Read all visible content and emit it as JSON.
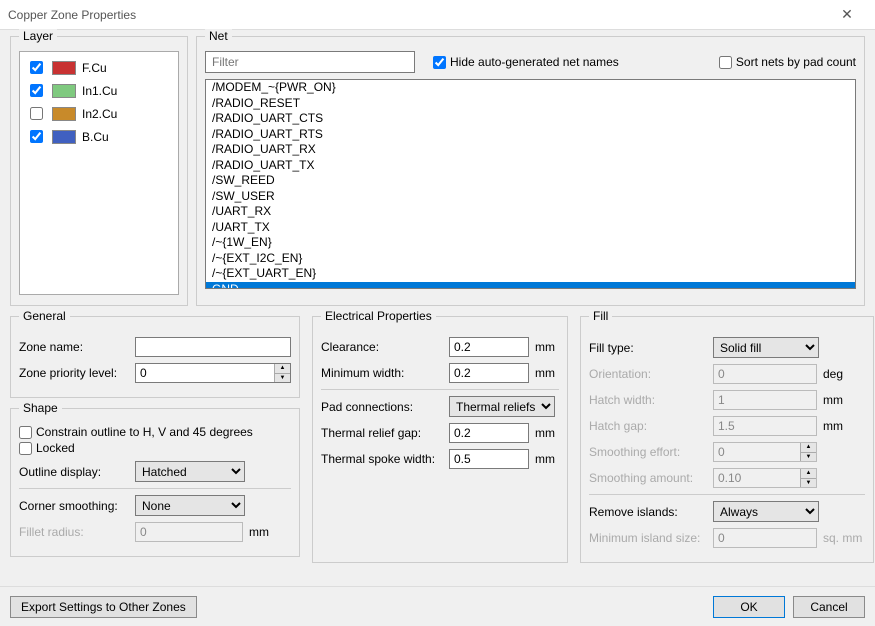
{
  "window": {
    "title": "Copper Zone Properties"
  },
  "layer": {
    "group_title": "Layer",
    "items": [
      {
        "name": "F.Cu",
        "color": "#c83232",
        "checked": true
      },
      {
        "name": "In1.Cu",
        "color": "#7fc97f",
        "checked": true
      },
      {
        "name": "In2.Cu",
        "color": "#c88a2a",
        "checked": false
      },
      {
        "name": "B.Cu",
        "color": "#4060c0",
        "checked": true
      }
    ]
  },
  "net": {
    "group_title": "Net",
    "filter_placeholder": "Filter",
    "hide_auto": {
      "label": "Hide auto-generated net names",
      "checked": true
    },
    "sort_by_pad": {
      "label": "Sort nets by pad count",
      "checked": false
    },
    "items": [
      "/MODEM_~{PWR_ON}",
      "/RADIO_RESET",
      "/RADIO_UART_CTS",
      "/RADIO_UART_RTS",
      "/RADIO_UART_RX",
      "/RADIO_UART_TX",
      "/SW_REED",
      "/SW_USER",
      "/UART_RX",
      "/UART_TX",
      "/~{1W_EN}",
      "/~{EXT_I2C_EN}",
      "/~{EXT_UART_EN}",
      "GND"
    ],
    "selected_index": 13
  },
  "general": {
    "group_title": "General",
    "zone_name_label": "Zone name:",
    "zone_name_value": "",
    "zone_priority_label": "Zone priority level:",
    "zone_priority_value": "0"
  },
  "shape": {
    "group_title": "Shape",
    "constrain_label": "Constrain outline to H, V and 45 degrees",
    "constrain_checked": false,
    "locked_label": "Locked",
    "locked_checked": false,
    "outline_display_label": "Outline display:",
    "outline_display_value": "Hatched",
    "corner_smoothing_label": "Corner smoothing:",
    "corner_smoothing_value": "None",
    "fillet_radius_label": "Fillet radius:",
    "fillet_radius_value": "0",
    "fillet_radius_unit": "mm"
  },
  "electrical": {
    "group_title": "Electrical Properties",
    "clearance_label": "Clearance:",
    "clearance_value": "0.2",
    "min_width_label": "Minimum width:",
    "min_width_value": "0.2",
    "pad_conn_label": "Pad connections:",
    "pad_conn_value": "Thermal reliefs",
    "thermal_gap_label": "Thermal relief gap:",
    "thermal_gap_value": "0.2",
    "thermal_spoke_label": "Thermal spoke width:",
    "thermal_spoke_value": "0.5",
    "unit_mm": "mm"
  },
  "fill": {
    "group_title": "Fill",
    "fill_type_label": "Fill type:",
    "fill_type_value": "Solid fill",
    "orientation_label": "Orientation:",
    "orientation_value": "0",
    "orientation_unit": "deg",
    "hatch_width_label": "Hatch width:",
    "hatch_width_value": "1",
    "hatch_gap_label": "Hatch gap:",
    "hatch_gap_value": "1.5",
    "smoothing_effort_label": "Smoothing effort:",
    "smoothing_effort_value": "0",
    "smoothing_amount_label": "Smoothing amount:",
    "smoothing_amount_value": "0.10",
    "remove_islands_label": "Remove islands:",
    "remove_islands_value": "Always",
    "min_island_label": "Minimum island size:",
    "min_island_value": "0",
    "min_island_unit": "sq. mm",
    "unit_mm": "mm"
  },
  "footer": {
    "export_label": "Export Settings to Other Zones",
    "ok_label": "OK",
    "cancel_label": "Cancel"
  }
}
